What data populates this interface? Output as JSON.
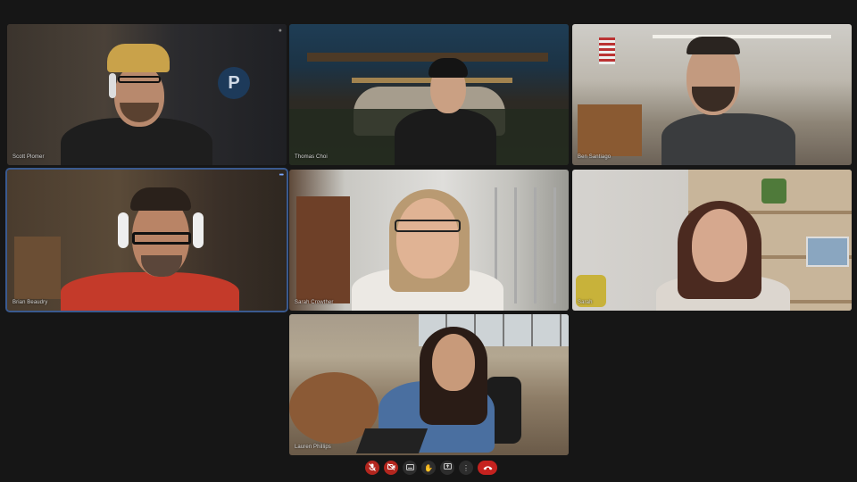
{
  "participants": [
    {
      "name": "Scott Plomer"
    },
    {
      "name": "Thomas Choi"
    },
    {
      "name": "Ben Santiago"
    },
    {
      "name": "Brian Beaudry"
    },
    {
      "name": "Sarah Crowther"
    },
    {
      "name": "Sarah"
    },
    {
      "name": "Lauren Phillips"
    }
  ],
  "controls": [
    {
      "name": "mic-off",
      "icon": "mic-off-icon",
      "state": "muted"
    },
    {
      "name": "camera-off",
      "icon": "camera-off-icon",
      "state": "off"
    },
    {
      "name": "captions",
      "icon": "captions-icon"
    },
    {
      "name": "raise-hand",
      "icon": "hand-icon"
    },
    {
      "name": "present",
      "icon": "present-screen-icon"
    },
    {
      "name": "more-options",
      "icon": "more-vertical-icon"
    },
    {
      "name": "leave-call",
      "icon": "phone-hangup-icon"
    }
  ],
  "colors": {
    "background": "#161616",
    "danger": "#c5221f",
    "active_border": "#3a5a8f"
  }
}
